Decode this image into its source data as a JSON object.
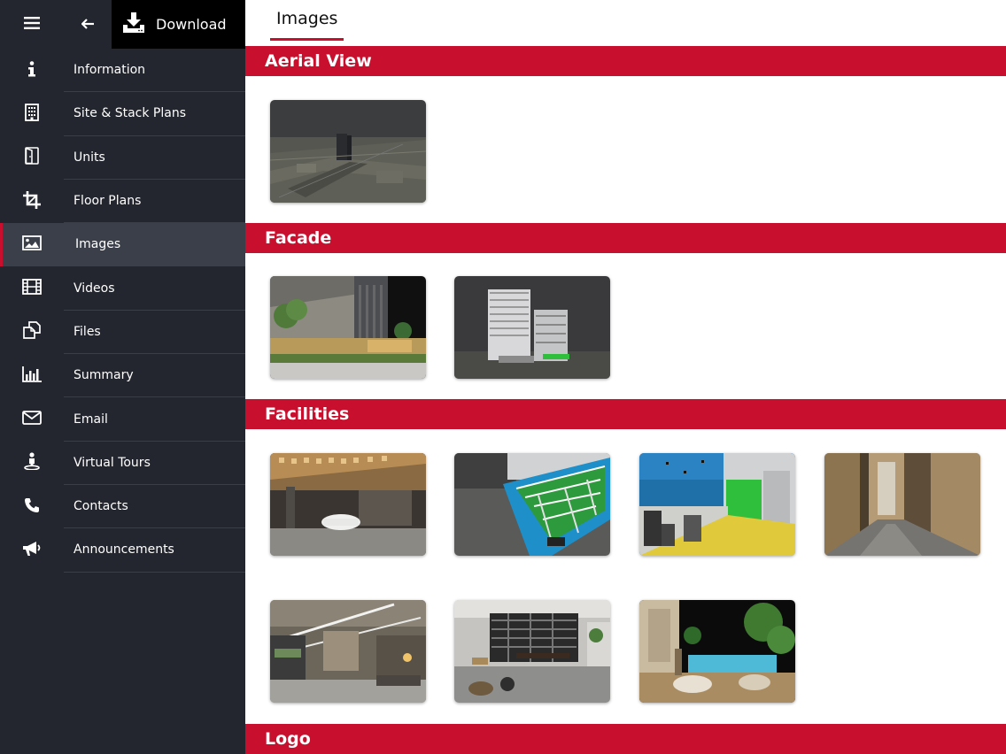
{
  "header": {
    "menu_icon": "hamburger-icon",
    "back_icon": "arrow-left-icon",
    "download_icon": "download-icon",
    "download_label": "Download"
  },
  "sidebar": {
    "items": [
      {
        "label": "Information",
        "icon": "info-icon"
      },
      {
        "label": "Site & Stack Plans",
        "icon": "building-icon"
      },
      {
        "label": "Units",
        "icon": "door-icon"
      },
      {
        "label": "Floor Plans",
        "icon": "crop-icon"
      },
      {
        "label": "Images",
        "icon": "image-icon",
        "active": true
      },
      {
        "label": "Videos",
        "icon": "film-icon"
      },
      {
        "label": "Files",
        "icon": "files-icon"
      },
      {
        "label": "Summary",
        "icon": "bar-chart-icon"
      },
      {
        "label": "Email",
        "icon": "envelope-icon"
      },
      {
        "label": "Virtual Tours",
        "icon": "person-pin-icon"
      },
      {
        "label": "Contacts",
        "icon": "phone-icon"
      },
      {
        "label": "Announcements",
        "icon": "megaphone-icon"
      }
    ]
  },
  "main": {
    "tab_label": "Images",
    "sections": [
      {
        "title": "Aerial View",
        "image_count": 1
      },
      {
        "title": "Facade",
        "image_count": 2
      },
      {
        "title": "Facilities",
        "image_count": 7
      },
      {
        "title": "Logo",
        "image_count": 0
      }
    ]
  },
  "colors": {
    "accent": "#c8102e",
    "sidebar_bg": "#23262e",
    "sidebar_active": "#3a3f49",
    "download_bg": "#000000"
  }
}
